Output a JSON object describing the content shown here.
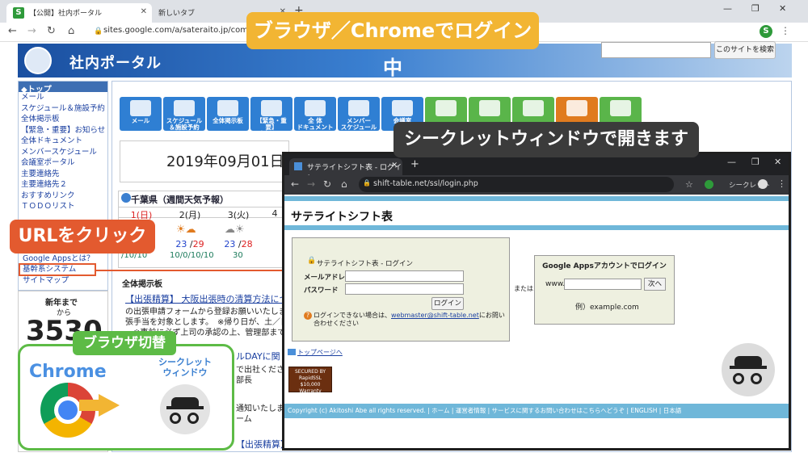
{
  "main_browser": {
    "tabs": [
      {
        "label": "【公開】社内ポータル",
        "active": true
      },
      {
        "label": "新しいタブ",
        "active": false
      }
    ],
    "url": "sites.google.com/a/sateraito.jp/compa",
    "profile_initial": "S",
    "search_button": "このサイトを検索"
  },
  "portal": {
    "title": "社内ポータル",
    "sidebar_header": "◆トップ",
    "sidebar_items": [
      "メール",
      "スケジュール＆施設予約",
      "全体掲示板",
      "【緊急・重要】お知らせ",
      "全体ドキュメント",
      "メンバースケジュール",
      "会議室ポータル",
      "主要連絡先",
      "主要連絡先２",
      "おすすめリンク",
      "ＴＯＤＯリスト"
    ],
    "sidebar_items_lower": [
      "Google Appsとは？",
      "基幹系システム",
      "サイトマップ"
    ],
    "new_year_title": "新年まで",
    "new_year_from": "から",
    "countdown": "3530",
    "icon_buttons": [
      {
        "label": "メール",
        "color": "#2f7fd3"
      },
      {
        "label": "スケジュール\n＆施設予約",
        "color": "#2f7fd3"
      },
      {
        "label": "全体掲示板",
        "color": "#2f7fd3"
      },
      {
        "label": "【緊急・重要】\nお知らせ",
        "color": "#2f7fd3"
      },
      {
        "label": "全 体\nドキュメント",
        "color": "#2f7fd3"
      },
      {
        "label": "メンバー\nスケジュール",
        "color": "#2f7fd3"
      },
      {
        "label": "会議室",
        "color": "#2f7fd3"
      },
      {
        "label": "",
        "color": "#5ab54a"
      },
      {
        "label": "",
        "color": "#5ab54a"
      },
      {
        "label": "",
        "color": "#5ab54a"
      },
      {
        "label": "",
        "color": "#e07b1f"
      },
      {
        "label": "",
        "color": "#5ab54a"
      }
    ],
    "date": "2019年09月01日",
    "weather_title": "千葉県（週間天気予報）",
    "weather_days": [
      {
        "day": "1(日)",
        "hi": "",
        "lo": ""
      },
      {
        "day": "2(月)",
        "hi": "23",
        "lo": "29",
        "rain": "10/0/10/10"
      },
      {
        "day": "3(火)",
        "hi": "23",
        "lo": "28",
        "rain": "30"
      },
      {
        "day": "4",
        "hi": "",
        "lo": ""
      }
    ],
    "weather_rain_first": "/10/10",
    "bulletin_title": "全体掲示板",
    "bulletin_lines": [
      "【出張精算】 大阪出張時の清算方法につい",
      "の出張申請フォームから登録お願いいたします。",
      "張手当を対象とします。　※帰り日が、土／日／",
      "　※事前に必ず上司の承認の上、管理部まで",
      "ルDAYに関し",
      "で出社くださ",
      "部長",
      "通知いたしま",
      "ーム",
      "【出張精算】 大阪出張時の清算方法につい"
    ]
  },
  "overlays": {
    "banner_top": "ブラウザ／Chromeでログイン中",
    "banner_incognito": "シークレットウィンドウで開きます",
    "url_click": "URLをクリック",
    "switch_title": "ブラウザ切替",
    "switch_chrome": "Chrome",
    "switch_incognito": "シークレット\nウィンドウ"
  },
  "incognito_window": {
    "tab_label": "サテライトシフト表 - ログイン",
    "url": "shift-table.net/ssl/login.php",
    "profile_label": "シークレット",
    "page_title": "サテライトシフト表",
    "login_box_title": "サテライトシフト表 - ログイン",
    "email_label": "メールアドレス",
    "password_label": "パスワード",
    "login_button": "ログイン",
    "help_prefix": "ログインできない場合は、",
    "help_email": "webmaster@shift-table.net",
    "help_suffix": "にお問い合わせください",
    "or_text": "または",
    "gapps_title": "Google Appsアカウントでログイン",
    "gapps_prefix": "www.",
    "next_button": "次へ",
    "example_text": "例）example.com",
    "top_link": "トップページへ",
    "ssl_badge": "SECURED BY\nRapidSSL\n$10,000 Warranty",
    "footer": "Copyright (c) Akitoshi Abe all rights reserved. | ホーム | 運営者情報 | サービスに関するお問い合わせはこちらへどうぞ | ENGLISH | 日本語"
  }
}
